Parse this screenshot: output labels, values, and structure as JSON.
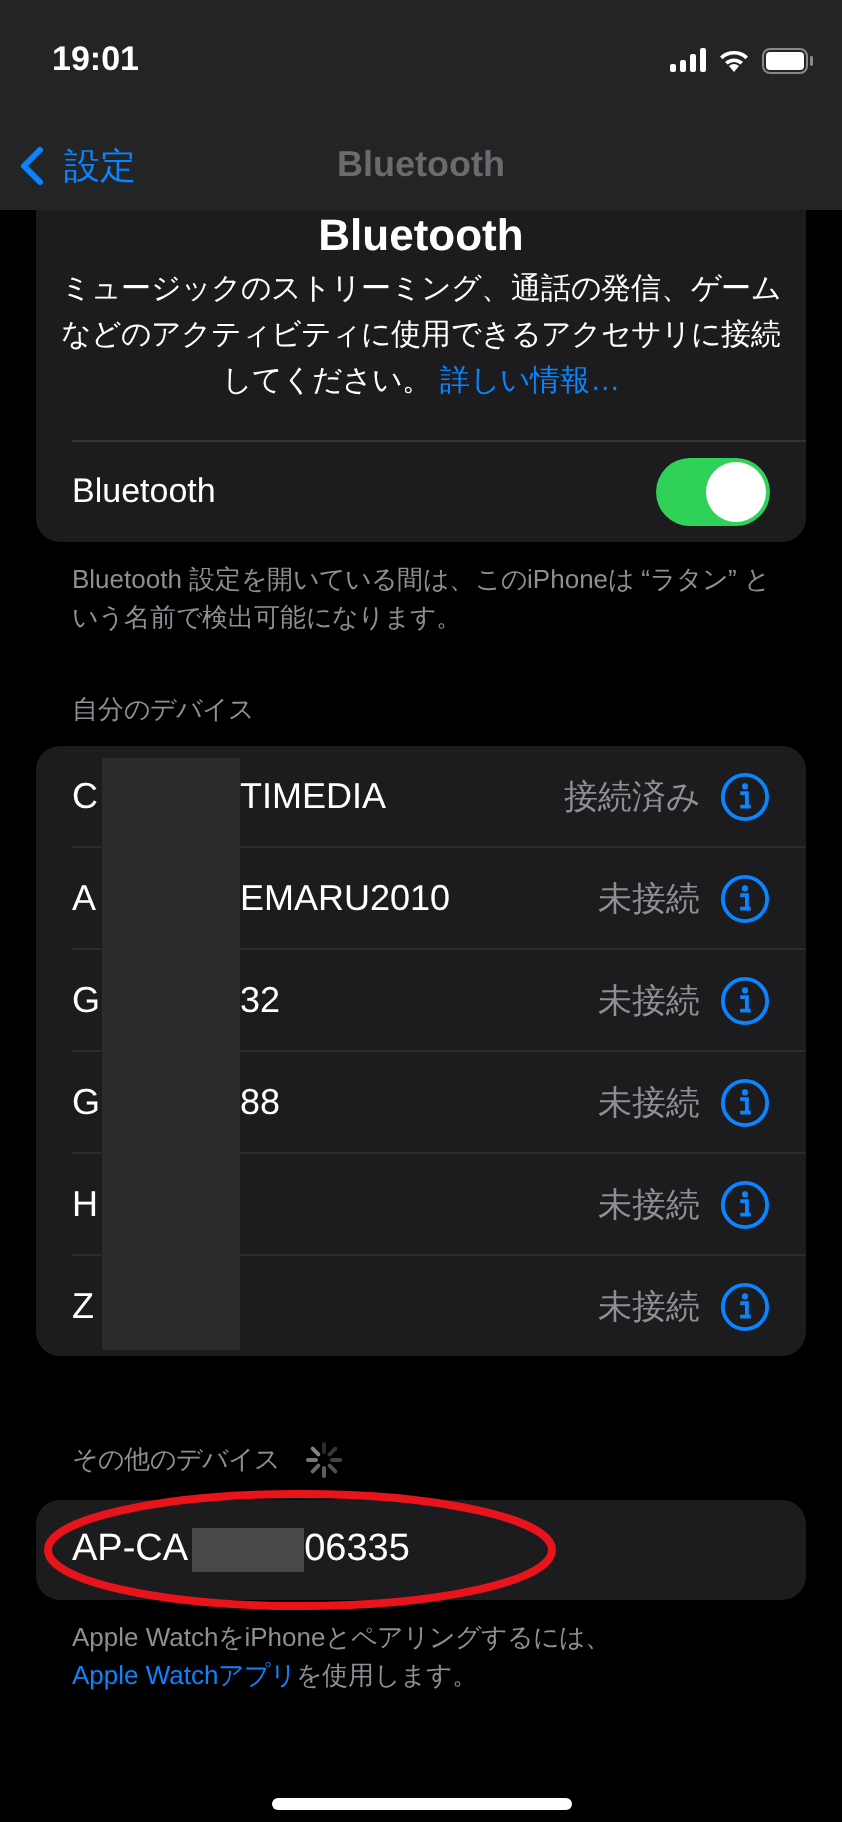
{
  "status_bar": {
    "time": "19:01"
  },
  "nav": {
    "back_label": "設定",
    "title": "Bluetooth"
  },
  "intro_card": {
    "heading": "Bluetooth",
    "description": "ミュージックのストリーミング、通話の発信、ゲームなどのアクティビティに使用できるアクセサリに接続してください。",
    "link": "詳しい情報…",
    "toggle": {
      "label": "Bluetooth",
      "on": true
    }
  },
  "discoverable_note": "Bluetooth 設定を開いている間は、このiPhoneは “ラタン” という名前で検出可能になります。",
  "my_devices": {
    "header": "自分のデバイス",
    "items": [
      {
        "name_start": "C",
        "name_end": "TIMEDIA",
        "status": "接続済み"
      },
      {
        "name_start": "A",
        "name_end": "EMARU2010",
        "status": "未接続"
      },
      {
        "name_start": "G",
        "name_end": "32",
        "status": "未接続"
      },
      {
        "name_start": "G",
        "name_end": "88",
        "status": "未接続"
      },
      {
        "name_start": "H",
        "status": "未接続"
      },
      {
        "name_start": "Z",
        "status": "未接続"
      }
    ]
  },
  "other_devices": {
    "header": "その他のデバイス",
    "searching": true,
    "items": [
      {
        "name_start": "AP-CA",
        "name_end": "06335"
      }
    ]
  },
  "watch_note": {
    "text": "Apple WatchをiPhoneとペアリングするには、",
    "link": "Apple Watchアプリ",
    "text_after": "を使用します。"
  }
}
